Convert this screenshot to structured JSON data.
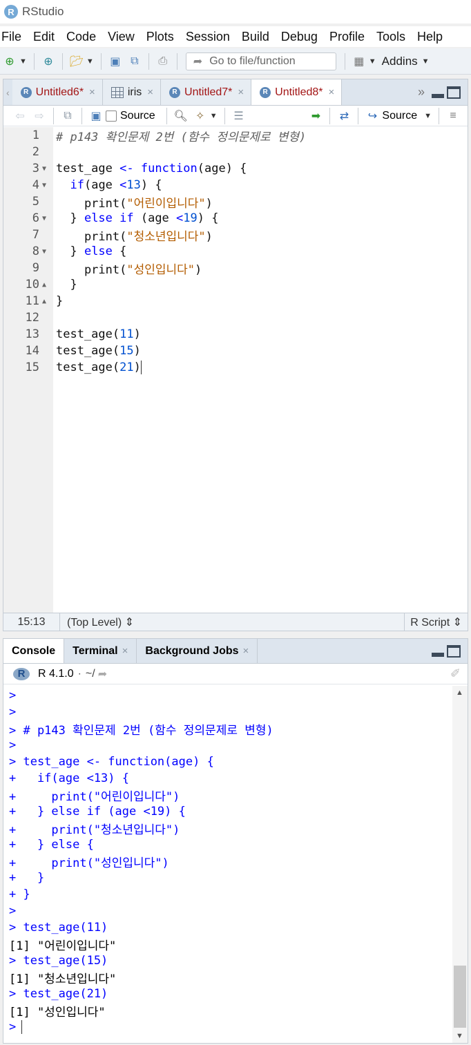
{
  "window": {
    "title": "RStudio"
  },
  "menu": [
    "File",
    "Edit",
    "Code",
    "View",
    "Plots",
    "Session",
    "Build",
    "Debug",
    "Profile",
    "Tools",
    "Help"
  ],
  "toolbar": {
    "goto_placeholder": "Go to file/function",
    "addins_label": "Addins"
  },
  "editor": {
    "tabs": [
      {
        "label": "Untitled6*",
        "type": "r"
      },
      {
        "label": "iris",
        "type": "data"
      },
      {
        "label": "Untitled7*",
        "type": "r"
      },
      {
        "label": "Untitled8*",
        "type": "r",
        "active": true
      }
    ],
    "toolbar": {
      "source_on_save": "Source",
      "source_button": "Source"
    },
    "lines": [
      {
        "n": "1",
        "fold": "",
        "parts": [
          [
            "comment",
            "# p143 확인문제 2번 (함수 정의문제로 변형)"
          ]
        ]
      },
      {
        "n": "2",
        "fold": "",
        "parts": []
      },
      {
        "n": "3",
        "fold": "▼",
        "parts": [
          [
            "id",
            "test_age "
          ],
          [
            "op",
            "<-"
          ],
          [
            "id",
            " "
          ],
          [
            "kw",
            "function"
          ],
          [
            "id",
            "(age) {"
          ]
        ]
      },
      {
        "n": "4",
        "fold": "▼",
        "parts": [
          [
            "id",
            "  "
          ],
          [
            "kw",
            "if"
          ],
          [
            "id",
            "(age "
          ],
          [
            "op",
            "<"
          ],
          [
            "num",
            "13"
          ],
          [
            "id",
            ") {"
          ]
        ]
      },
      {
        "n": "5",
        "fold": "",
        "parts": [
          [
            "id",
            "    print("
          ],
          [
            "str",
            "\"어린이입니다\""
          ],
          [
            "id",
            ")"
          ]
        ]
      },
      {
        "n": "6",
        "fold": "▼",
        "parts": [
          [
            "id",
            "  } "
          ],
          [
            "kw",
            "else if"
          ],
          [
            "id",
            " (age "
          ],
          [
            "op",
            "<"
          ],
          [
            "num",
            "19"
          ],
          [
            "id",
            ") {"
          ]
        ]
      },
      {
        "n": "7",
        "fold": "",
        "parts": [
          [
            "id",
            "    print("
          ],
          [
            "str",
            "\"청소년입니다\""
          ],
          [
            "id",
            ")"
          ]
        ]
      },
      {
        "n": "8",
        "fold": "▼",
        "parts": [
          [
            "id",
            "  } "
          ],
          [
            "kw",
            "else"
          ],
          [
            "id",
            " {"
          ]
        ]
      },
      {
        "n": "9",
        "fold": "",
        "parts": [
          [
            "id",
            "    print("
          ],
          [
            "str",
            "\"성인입니다\""
          ],
          [
            "id",
            ")"
          ]
        ]
      },
      {
        "n": "10",
        "fold": "▲",
        "parts": [
          [
            "id",
            "  }"
          ]
        ]
      },
      {
        "n": "11",
        "fold": "▲",
        "parts": [
          [
            "id",
            "}"
          ]
        ]
      },
      {
        "n": "12",
        "fold": "",
        "parts": []
      },
      {
        "n": "13",
        "fold": "",
        "parts": [
          [
            "id",
            "test_age("
          ],
          [
            "num",
            "11"
          ],
          [
            "id",
            ")"
          ]
        ]
      },
      {
        "n": "14",
        "fold": "",
        "parts": [
          [
            "id",
            "test_age("
          ],
          [
            "num",
            "15"
          ],
          [
            "id",
            ")"
          ]
        ]
      },
      {
        "n": "15",
        "fold": "",
        "parts": [
          [
            "id",
            "test_age("
          ],
          [
            "num",
            "21"
          ],
          [
            "id",
            ")"
          ]
        ],
        "cursor": true
      }
    ],
    "status": {
      "position": "15:13",
      "scope": "(Top Level) ⇕",
      "file_type": "R Script ⇕"
    }
  },
  "console": {
    "tabs": [
      {
        "label": "Console",
        "active": true,
        "closable": false
      },
      {
        "label": "Terminal",
        "closable": true
      },
      {
        "label": "Background Jobs",
        "closable": true
      }
    ],
    "r_version": "R 4.1.0",
    "path": "~/",
    "lines": [
      {
        "kind": "in",
        "text": ">"
      },
      {
        "kind": "in",
        "text": ">"
      },
      {
        "kind": "in",
        "text": "> # p143 확인문제 2번 (함수 정의문제로 변형)"
      },
      {
        "kind": "in",
        "text": ">"
      },
      {
        "kind": "in",
        "text": "> test_age <- function(age) {"
      },
      {
        "kind": "in",
        "text": "+   if(age <13) {"
      },
      {
        "kind": "in",
        "text": "+     print(\"어린이입니다\")"
      },
      {
        "kind": "in",
        "text": "+   } else if (age <19) {"
      },
      {
        "kind": "in",
        "text": "+     print(\"청소년입니다\")"
      },
      {
        "kind": "in",
        "text": "+   } else {"
      },
      {
        "kind": "in",
        "text": "+     print(\"성인입니다\")"
      },
      {
        "kind": "in",
        "text": "+   }"
      },
      {
        "kind": "in",
        "text": "+ }"
      },
      {
        "kind": "in",
        "text": ">"
      },
      {
        "kind": "in",
        "text": "> test_age(11)"
      },
      {
        "kind": "out",
        "text": "[1] \"어린이입니다\""
      },
      {
        "kind": "in",
        "text": "> test_age(15)"
      },
      {
        "kind": "out",
        "text": "[1] \"청소년입니다\""
      },
      {
        "kind": "in",
        "text": "> test_age(21)"
      },
      {
        "kind": "out",
        "text": "[1] \"성인입니다\""
      },
      {
        "kind": "in",
        "text": ">",
        "cursor": true
      }
    ]
  }
}
